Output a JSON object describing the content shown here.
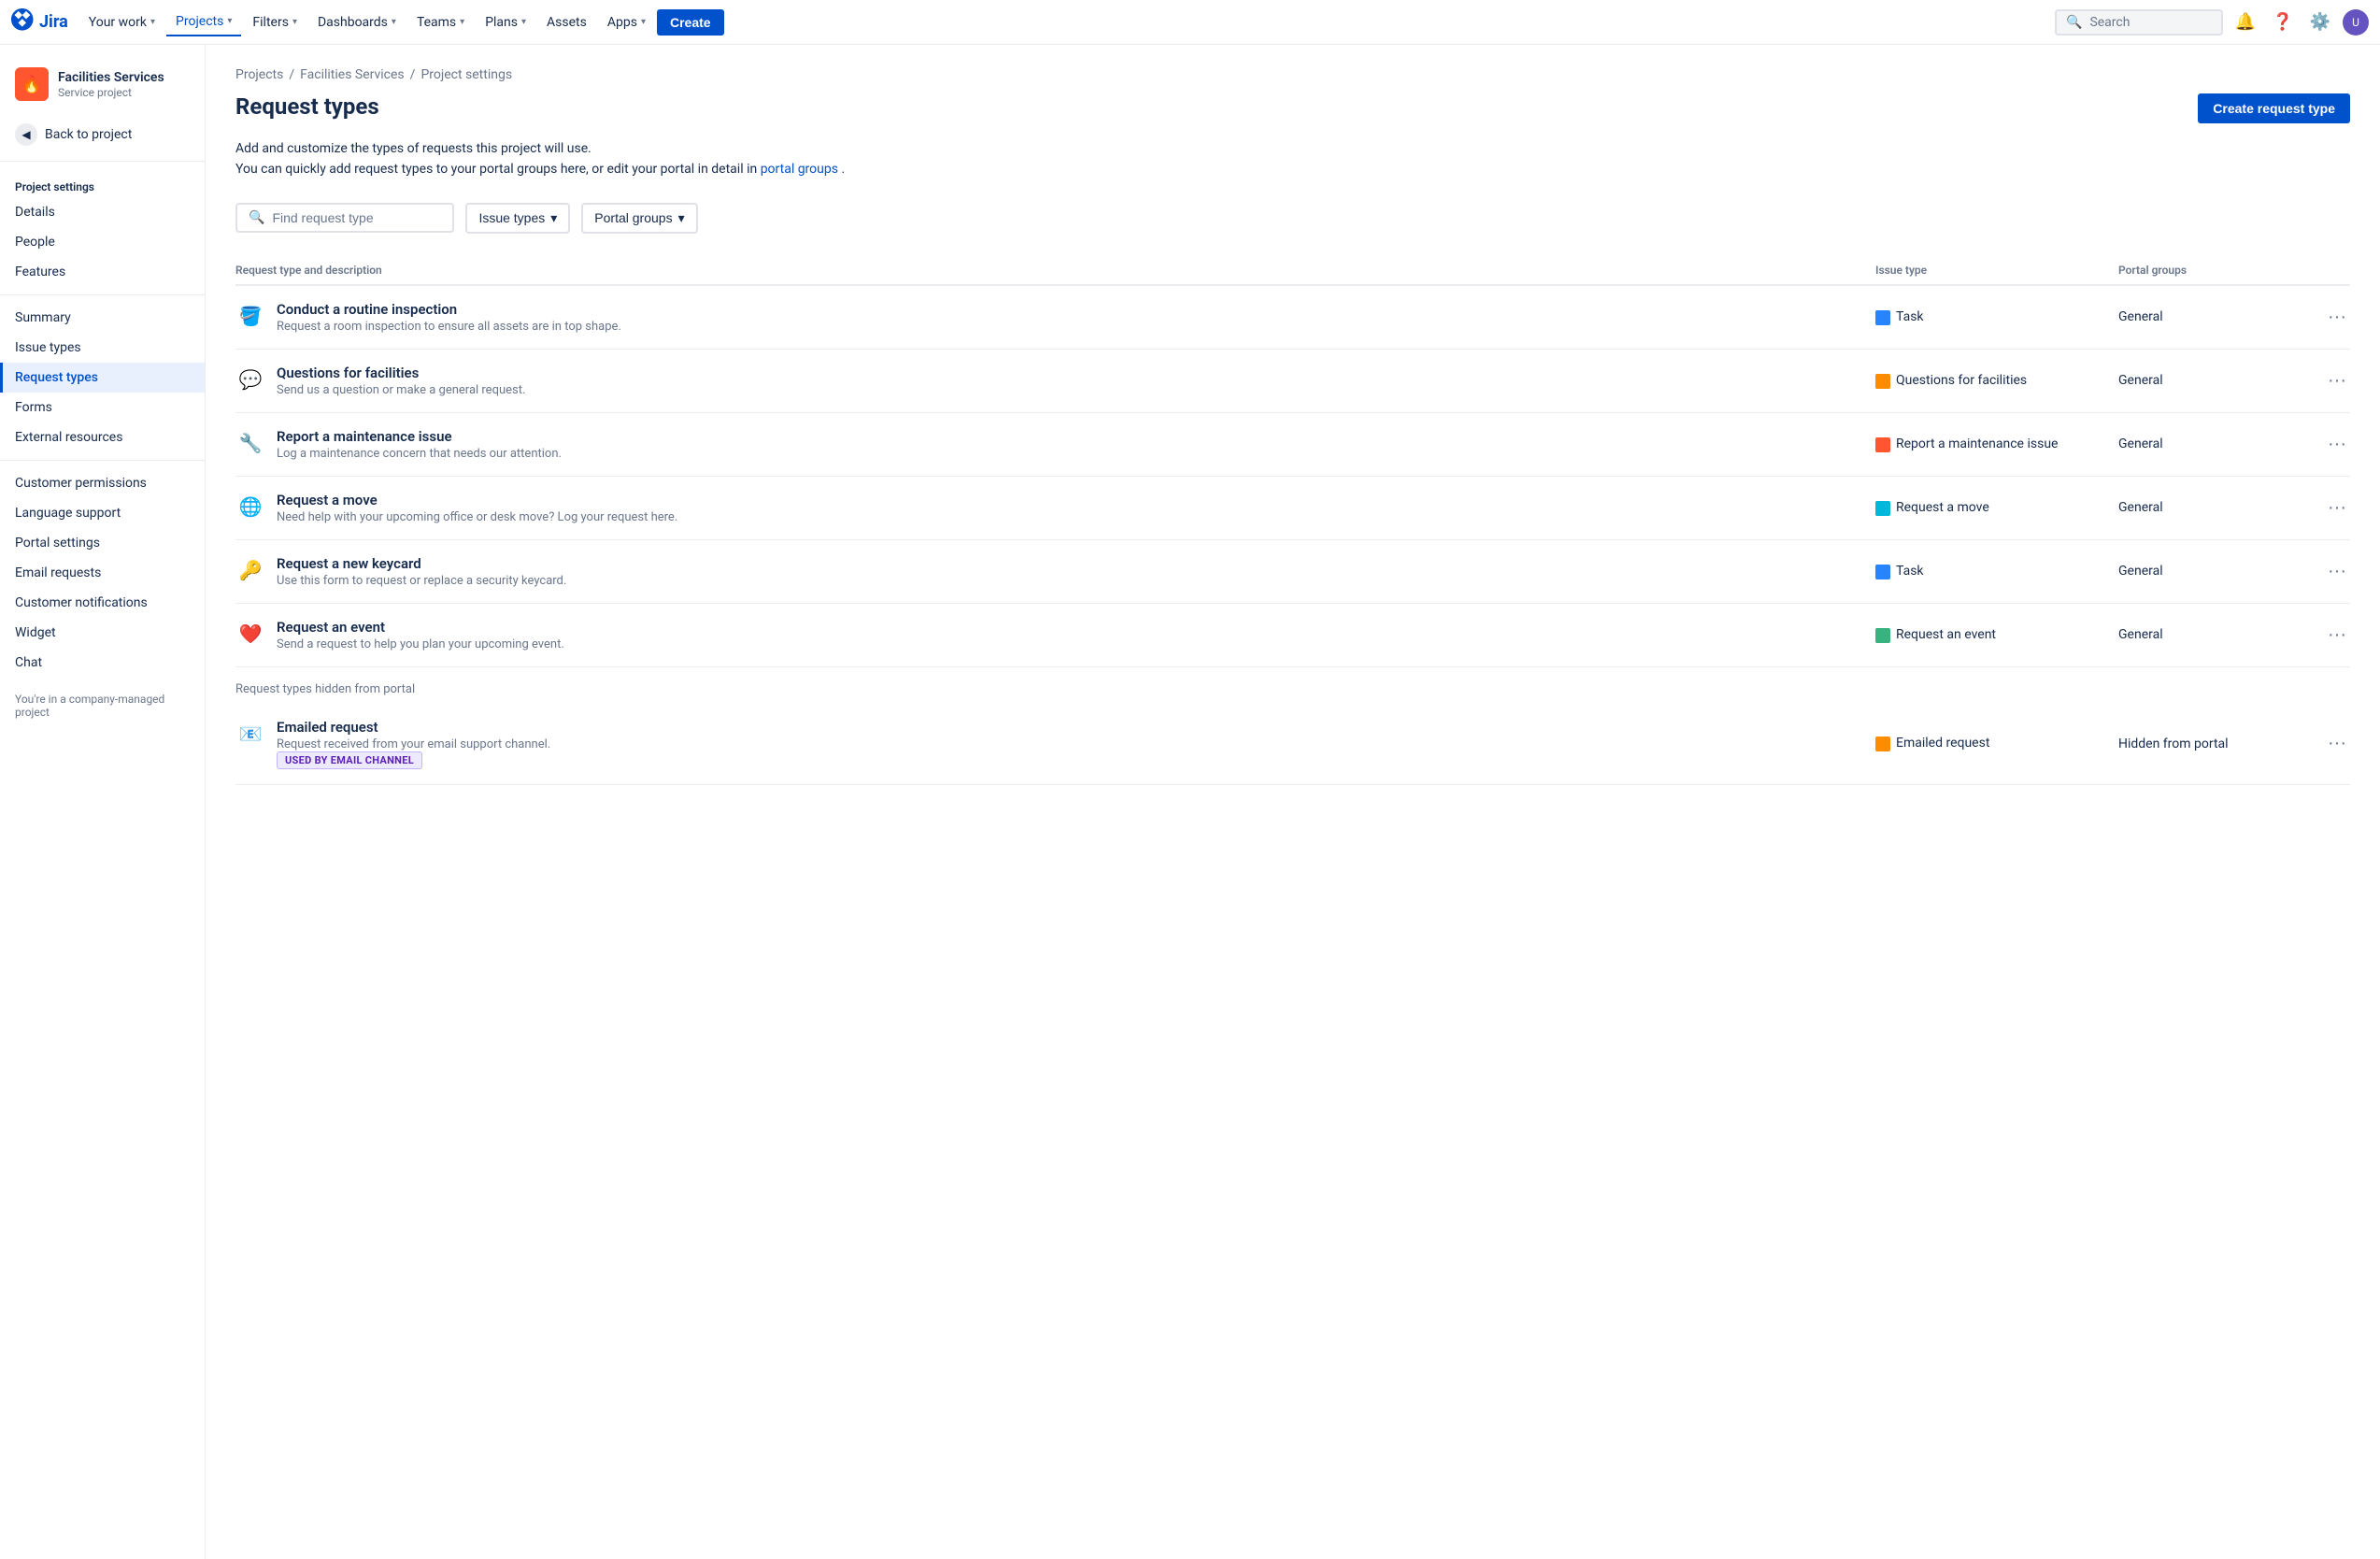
{
  "topnav": {
    "logo_text": "Jira",
    "your_work": "Your work",
    "projects": "Projects",
    "filters": "Filters",
    "dashboards": "Dashboards",
    "teams": "Teams",
    "plans": "Plans",
    "assets": "Assets",
    "apps": "Apps",
    "create_label": "Create",
    "search_placeholder": "Search"
  },
  "sidebar": {
    "project_name": "Facilities Services",
    "project_type": "Service project",
    "back_label": "Back to project",
    "section_title": "Project settings",
    "items": [
      {
        "id": "details",
        "label": "Details"
      },
      {
        "id": "people",
        "label": "People"
      },
      {
        "id": "features",
        "label": "Features"
      },
      {
        "id": "summary",
        "label": "Summary"
      },
      {
        "id": "issue-types",
        "label": "Issue types"
      },
      {
        "id": "request-types",
        "label": "Request types",
        "active": true
      },
      {
        "id": "forms",
        "label": "Forms"
      },
      {
        "id": "external-resources",
        "label": "External resources"
      },
      {
        "id": "customer-permissions",
        "label": "Customer permissions"
      },
      {
        "id": "language-support",
        "label": "Language support"
      },
      {
        "id": "portal-settings",
        "label": "Portal settings"
      },
      {
        "id": "email-requests",
        "label": "Email requests"
      },
      {
        "id": "customer-notifications",
        "label": "Customer notifications"
      },
      {
        "id": "widget",
        "label": "Widget"
      },
      {
        "id": "chat",
        "label": "Chat"
      }
    ],
    "footer": "You're in a company-managed project"
  },
  "breadcrumb": {
    "items": [
      "Projects",
      "Facilities Services",
      "Project settings"
    ]
  },
  "page": {
    "title": "Request types",
    "create_btn": "Create request type",
    "desc_line1": "Add and customize the types of requests this project will use.",
    "desc_line2_prefix": "You can quickly add request types to your portal groups here, or edit your portal in detail in ",
    "desc_link": "portal groups",
    "desc_line2_suffix": ".",
    "filter_placeholder": "Find request type",
    "issue_types_btn": "Issue types",
    "portal_groups_btn": "Portal groups",
    "col_request_type": "Request type and description",
    "col_issue_type": "Issue type",
    "col_portal_groups": "Portal groups",
    "hidden_section_label": "Request types hidden from portal"
  },
  "request_types": [
    {
      "icon": "🪣",
      "icon_emoji": "🪣",
      "name": "Conduct a routine inspection",
      "desc": "Request a room inspection to ensure all assets are in top shape.",
      "issue_type": "Task",
      "issue_type_class": "it-task",
      "issue_icon": "✓",
      "portal_group": "General"
    },
    {
      "icon": "🔧",
      "icon_emoji": "💬",
      "name": "Questions for facilities",
      "desc": "Send us a question or make a general request.",
      "issue_type": "Questions for facilities",
      "issue_type_class": "it-question",
      "issue_icon": "?",
      "portal_group": "General"
    },
    {
      "icon": "🔨",
      "icon_emoji": "🔧",
      "name": "Report a maintenance issue",
      "desc": "Log a maintenance concern that needs our attention.",
      "issue_type": "Report a maintenance issue",
      "issue_type_class": "it-maintenance",
      "issue_icon": "!",
      "portal_group": "General"
    },
    {
      "icon": "🌐",
      "icon_emoji": "🌐",
      "name": "Request a move",
      "desc": "Need help with your upcoming office or desk move? Log your request here.",
      "issue_type": "Request a move",
      "issue_type_class": "it-move",
      "issue_icon": "↗",
      "portal_group": "General"
    },
    {
      "icon": "🗂️",
      "icon_emoji": "🔑",
      "name": "Request a new keycard",
      "desc": "Use this form to request or replace a security keycard.",
      "issue_type": "Task",
      "issue_type_class": "it-task",
      "issue_icon": "✓",
      "portal_group": "General"
    },
    {
      "icon": "❤️",
      "icon_emoji": "🎉",
      "name": "Request an event",
      "desc": "Send a request to help you plan your upcoming event.",
      "issue_type": "Request an event",
      "issue_type_class": "it-event",
      "issue_icon": "A",
      "portal_group": "General"
    }
  ],
  "hidden_request_types": [
    {
      "icon": "📧",
      "icon_emoji": "📧",
      "name": "Emailed request",
      "desc": "Request received from your email support channel.",
      "issue_type": "Emailed request",
      "issue_type_class": "it-email",
      "issue_icon": "@",
      "portal_group": "Hidden from portal",
      "badge": "USED BY EMAIL CHANNEL"
    }
  ]
}
